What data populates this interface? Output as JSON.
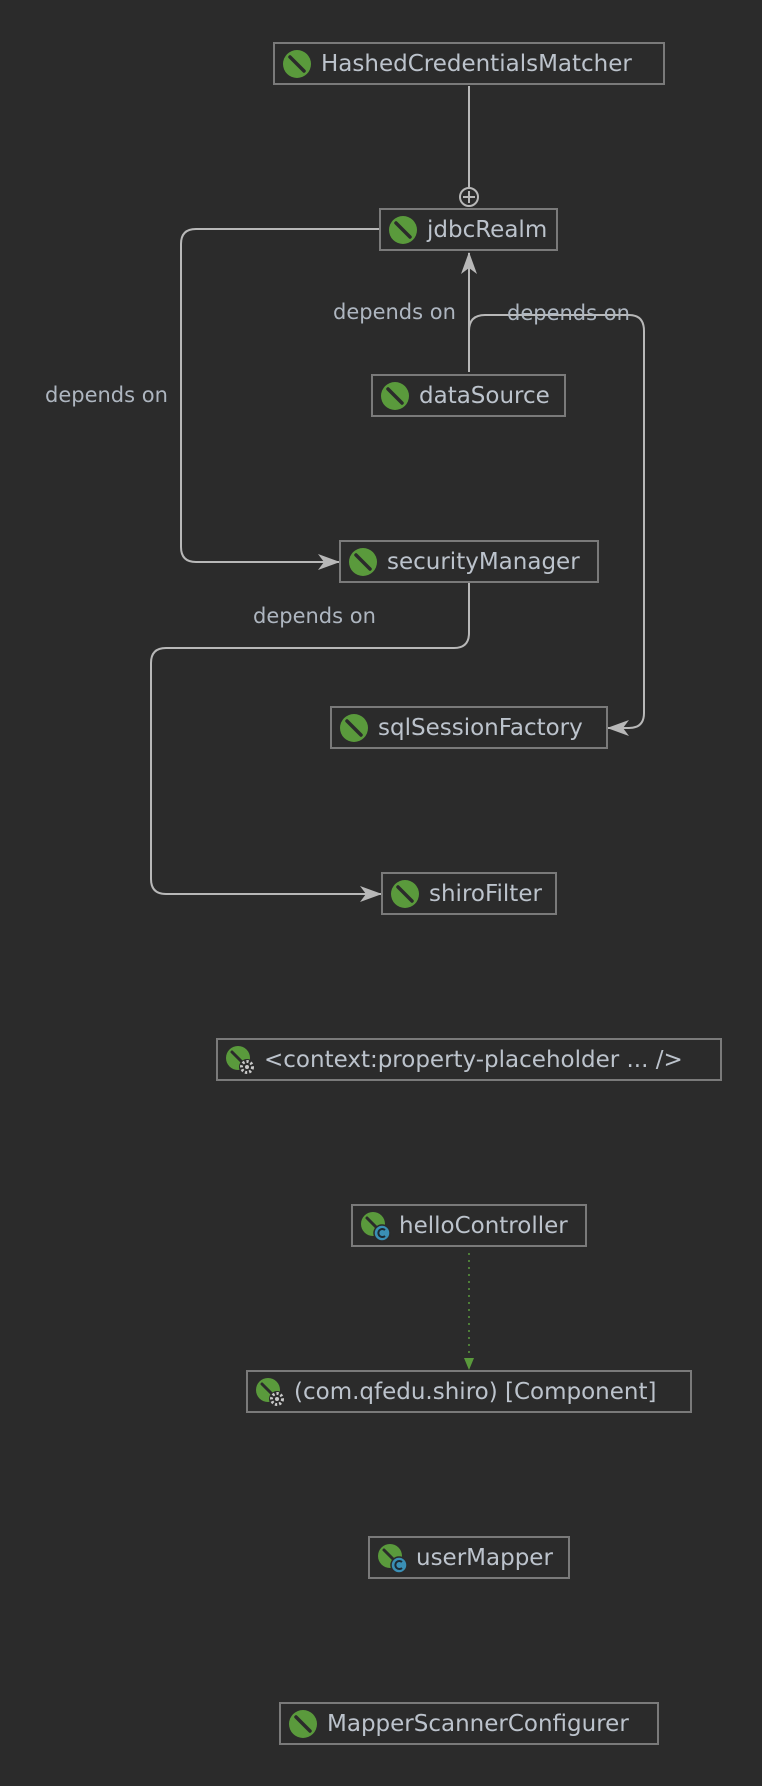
{
  "colors": {
    "background": "#2b2b2b",
    "node_border": "#7a7a7a",
    "text": "#bcc3cc",
    "edge": "#b8b8b8",
    "bean_green": "#5a9a3c",
    "component_edge": "#5a9a3c",
    "class_badge": "#3a8fb5"
  },
  "nodes": {
    "hashed": {
      "label": "HashedCredentialsMatcher",
      "icon": "spring-bean-icon"
    },
    "jdbcRealm": {
      "label": "jdbcRealm",
      "icon": "spring-bean-icon"
    },
    "dataSource": {
      "label": "dataSource",
      "icon": "spring-bean-icon"
    },
    "securityManager": {
      "label": "securityManager",
      "icon": "spring-bean-icon"
    },
    "sqlSessionFactory": {
      "label": "sqlSessionFactory",
      "icon": "spring-bean-icon"
    },
    "shiroFilter": {
      "label": "shiroFilter",
      "icon": "spring-bean-icon"
    },
    "propertyPlaceholder": {
      "label": "<context:property-placeholder ... />",
      "icon": "spring-config-gear-icon"
    },
    "helloController": {
      "label": "helloController",
      "icon": "spring-class-bean-icon"
    },
    "componentScan": {
      "label": "(com.qfedu.shiro) [Component]",
      "icon": "spring-config-gear-icon"
    },
    "userMapper": {
      "label": "userMapper",
      "icon": "spring-class-bean-icon"
    },
    "mapperScanner": {
      "label": "MapperScannerConfigurer",
      "icon": "spring-bean-icon"
    }
  },
  "edges": {
    "label_jdbc_security": "depends on",
    "label_ds_jdbc": "depends on",
    "label_ds_sql": "depends on",
    "label_security_shiro": "depends on"
  }
}
